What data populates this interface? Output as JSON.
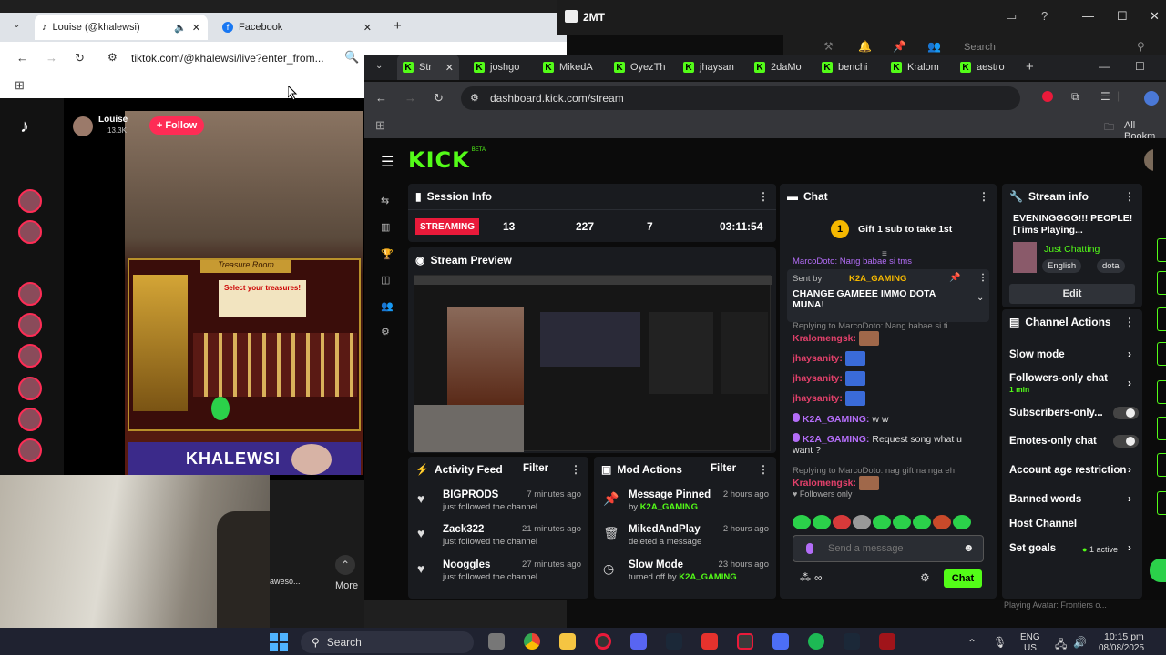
{
  "bg_browser": {
    "tabs": [
      "Louise (@khalewsi)",
      "Facebook"
    ],
    "url": "tiktok.com/@khalewsi/live?enter_from...",
    "streamer_name": "Louise",
    "streamer_likes": "13.3K",
    "follow_label": "+ Follow",
    "banner_text": "KHALEWSI",
    "treasure_title": "Treasure Room",
    "treasure_heading": "Select your treasures!",
    "side_bottom": [
      "aweso...",
      "More"
    ]
  },
  "desktop": {
    "app_title": "2MT",
    "search_placeholder": "Search"
  },
  "fg_browser": {
    "tabs": [
      "Str",
      "joshgo",
      "MikedA",
      "OyezTh",
      "jhaysan",
      "2daMo",
      "benchi",
      "Kralom",
      "aestro"
    ],
    "url": "dashboard.kick.com/stream",
    "bookmarks_label": "All Bookm"
  },
  "kick": {
    "logo": "KICK",
    "logo_badge": "BETA",
    "session": {
      "title": "Session Info",
      "status": "STREAMING",
      "stats": [
        "13",
        "227",
        "7",
        "03:11:54"
      ]
    },
    "preview_title": "Stream Preview",
    "activity": {
      "title": "Activity Feed",
      "filter": "Filter",
      "items": [
        {
          "name": "BIGPRODS",
          "sub": "just followed the channel",
          "time": "7 minutes ago"
        },
        {
          "name": "Zack322",
          "sub": "just followed the channel",
          "time": "21 minutes ago"
        },
        {
          "name": "Nooggles",
          "sub": "just followed the channel",
          "time": "27 minutes ago"
        }
      ]
    },
    "mod": {
      "title": "Mod Actions",
      "filter": "Filter",
      "items": [
        {
          "name": "Message Pinned",
          "sub_prefix": "by",
          "sub_user": "K2A_GAMING",
          "time": "2 hours ago"
        },
        {
          "name": "MikedAndPlay",
          "sub_prefix": "deleted a message",
          "sub_user": "",
          "time": "2 hours ago"
        },
        {
          "name": "Slow Mode",
          "sub_prefix": "turned off by",
          "sub_user": "K2A_GAMING",
          "time": "23 hours ago"
        }
      ]
    },
    "chat": {
      "title": "Chat",
      "gift_count": "1",
      "gift_text": "Gift 1 sub to take 1st",
      "scroll_cut": "MarcoDoto: Nang babae si tms",
      "pinned_by_prefix": "Sent by",
      "pinned_by": "K2A_GAMING",
      "pinned_text": "CHANGE GAMEEE IMMO DOTA MUNA!",
      "messages": [
        {
          "reply": "Replying to MarcoDoto: Nang babae si ti...",
          "user": "Kralomengsk:",
          "text": ""
        },
        {
          "reply": "",
          "user": "jhaysanity:",
          "text": ""
        },
        {
          "reply": "",
          "user": "jhaysanity:",
          "text": ""
        },
        {
          "reply": "",
          "user": "jhaysanity:",
          "text": ""
        },
        {
          "reply": "",
          "user": "K2A_GAMING:",
          "text": "w w"
        },
        {
          "reply": "",
          "user": "K2A_GAMING:",
          "text": "Request song what u want ?"
        },
        {
          "reply": "Replying to MarcoDoto: nag gift na nga eh",
          "user": "Kralomengsk:",
          "text": ""
        }
      ],
      "followers_only": "Followers only",
      "input_placeholder": "Send a message",
      "send_label": "Chat"
    },
    "stream_info": {
      "title": "Stream info",
      "stream_title": "EVENINGGGG!!! PEOPLE! [Tims Playing...",
      "category": "Just Chatting",
      "tags": [
        "English",
        "dota"
      ],
      "edit_label": "Edit"
    },
    "channel_actions": {
      "title": "Channel Actions",
      "items": [
        {
          "label": "Slow mode",
          "extra": ""
        },
        {
          "label": "Followers-only chat",
          "extra": "1 min"
        },
        {
          "label": "Subscribers-only...",
          "extra": ""
        },
        {
          "label": "Emotes-only chat",
          "extra": ""
        },
        {
          "label": "Account age restriction",
          "extra": ""
        },
        {
          "label": "Banned words",
          "extra": ""
        },
        {
          "label": "Host Channel",
          "extra": ""
        },
        {
          "label": "Set goals",
          "extra": "1 active"
        }
      ]
    }
  },
  "taskbar": {
    "search": "Search",
    "lang": "ENG",
    "region": "US",
    "time": "10:15 pm",
    "date": "08/08/2025",
    "hint": "Playing Avatar: Frontiers o..."
  },
  "colors": {
    "kick_green": "#53fc18",
    "streaming_red": "#e91a3a",
    "tiktok_pink": "#fe2c55"
  }
}
